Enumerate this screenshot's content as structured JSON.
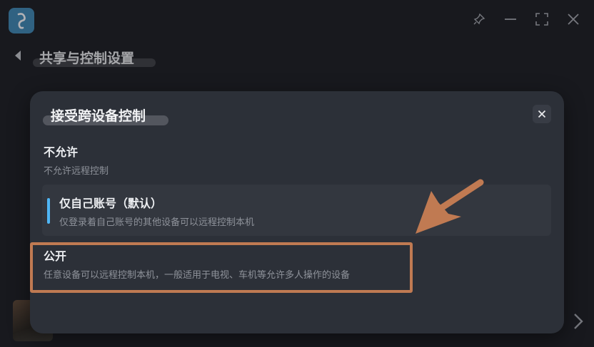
{
  "window": {
    "page_title": "共享与控制设置"
  },
  "modal": {
    "title": "接受跨设备控制",
    "options": [
      {
        "title": "不允许",
        "desc": "不允许远程控制"
      },
      {
        "title": "仅自己账号（默认）",
        "desc": "仅登录着自己账号的其他设备可以远程控制本机"
      },
      {
        "title": "公开",
        "desc": "任意设备可以远程控制本机，一般适用于电视、车机等允许多人操作的设备"
      }
    ]
  },
  "colors": {
    "accent": "#4fb6f5",
    "annotation": "#c07a52"
  }
}
